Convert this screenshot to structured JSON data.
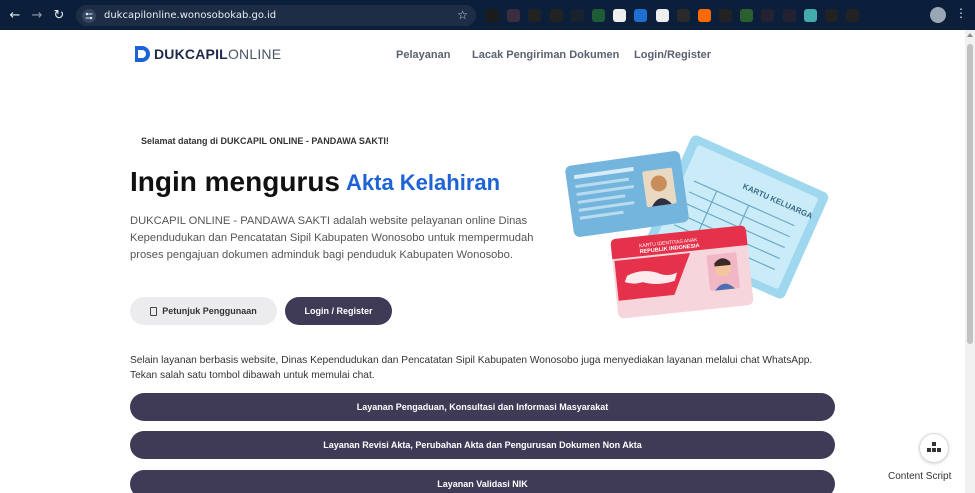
{
  "browser": {
    "url": "dukcapilonline.wonosobokab.go.id",
    "extension_colors": [
      "#1b1b1b",
      "#3a2d3f",
      "#222",
      "#222",
      "#1a2230",
      "#1d5c35",
      "#eeeeee",
      "#1f6fd1",
      "#eeeeee",
      "#2a2a2a",
      "#ff6a00",
      "#222",
      "#2c5f2e",
      "#223",
      "#223",
      "#4aa",
      "#222",
      "#222"
    ]
  },
  "header": {
    "logo_bold": "DUKCAPIL",
    "logo_light": "ONLINE",
    "nav": [
      "Pelayanan",
      "Lacak Pengiriman Dokumen",
      "Login/Register"
    ]
  },
  "hero": {
    "welcome": "Selamat datang di DUKCAPIL ONLINE - PANDAWA SAKTI!",
    "headline": "Ingin mengurus",
    "headline_accent": "Akta Kelahiran",
    "description": "DUKCAPIL ONLINE - PANDAWA SAKTI adalah website pelayanan online Dinas Kependudukan dan Pencatatan Sipil Kabupaten Wonosobo untuk mempermudah proses pengajuan dokumen adminduk bagi penduduk Kabupaten Wonosobo.",
    "guide_button": "Petunjuk Penggunaan",
    "login_button": "Login / Register"
  },
  "illustration": {
    "card_family": "KARTU KELUARGA",
    "card_child_line1": "KARTU IDENTITAS ANAK",
    "card_child_line2": "REPUBLIK INDONESIA"
  },
  "whatsapp": {
    "info": "Selain layanan berbasis website, Dinas Kependudukan dan Pencatatan Sipil Kabupaten Wonosobo juga menyediakan layanan melalui chat WhatsApp. Tekan salah satu tombol dibawah untuk memulai chat.",
    "buttons": [
      "Layanan Pengaduan, Konsultasi dan Informasi Masyarakat",
      "Layanan Revisi Akta, Perubahan Akta dan Pengurusan Dokumen Non Akta",
      "Layanan Validasi NIK"
    ]
  },
  "widget": {
    "label": "Content Script"
  }
}
